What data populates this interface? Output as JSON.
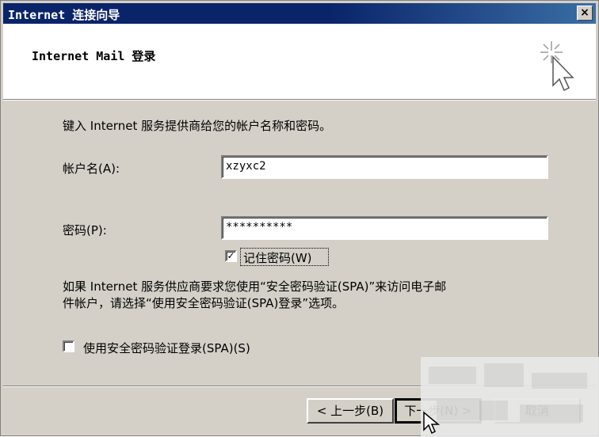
{
  "window": {
    "title": "Internet 连接向导",
    "close_label": "×"
  },
  "header": {
    "title": "Internet Mail 登录"
  },
  "main": {
    "instruction": "键入 Internet 服务提供商给您的帐户名称和密码。",
    "account_label": "帐户名(A):",
    "account_value": "xzyxc2",
    "password_label": "密码(P):",
    "password_value": "**********",
    "remember_label": "记住密码(W)",
    "remember_checked": "✓",
    "spa_note_line1": "如果 Internet 服务供应商要求您使用“安全密码验证(SPA)”来访问电子邮",
    "spa_note_line2": "件帐户，请选择“使用安全密码验证(SPA)登录”选项。",
    "spa_label": "使用安全密码验证登录(SPA)(S)"
  },
  "buttons": {
    "back": "< 上一步(B)",
    "next": "下一步(N) >",
    "cancel": "取消"
  },
  "icons": {
    "close": "close-icon",
    "wizard": "wizard-cursor-icon",
    "pointer": "mouse-pointer-icon"
  }
}
